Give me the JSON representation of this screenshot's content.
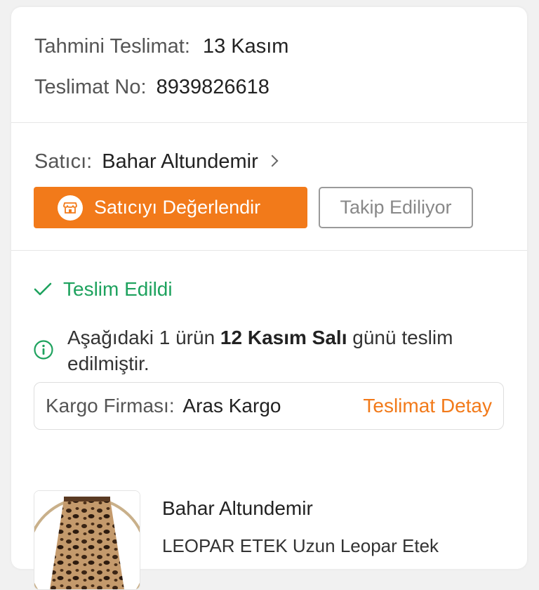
{
  "delivery": {
    "estimate_label": "Tahmini Teslimat:",
    "estimate_value": "13 Kasım",
    "number_label": "Teslimat No:",
    "number_value": "8939826618"
  },
  "seller": {
    "label": "Satıcı:",
    "name": "Bahar Altundemir",
    "rate_button": "Satıcıyı Değerlendir",
    "follow_button": "Takip Ediliyor"
  },
  "shipment": {
    "status": "Teslim Edildi",
    "info_prefix": "Aşağıdaki 1 ürün ",
    "info_date": "12 Kasım Salı",
    "info_suffix": " günü teslim edilmiştir.",
    "cargo_label": "Kargo Firması:",
    "cargo_value": "Aras Kargo",
    "detail_link": "Teslimat Detay"
  },
  "product": {
    "seller": "Bahar Altundemir",
    "name": "LEOPAR ETEK Uzun Leopar Etek"
  },
  "colors": {
    "accent": "#f27a1a",
    "success": "#1ea25e"
  }
}
